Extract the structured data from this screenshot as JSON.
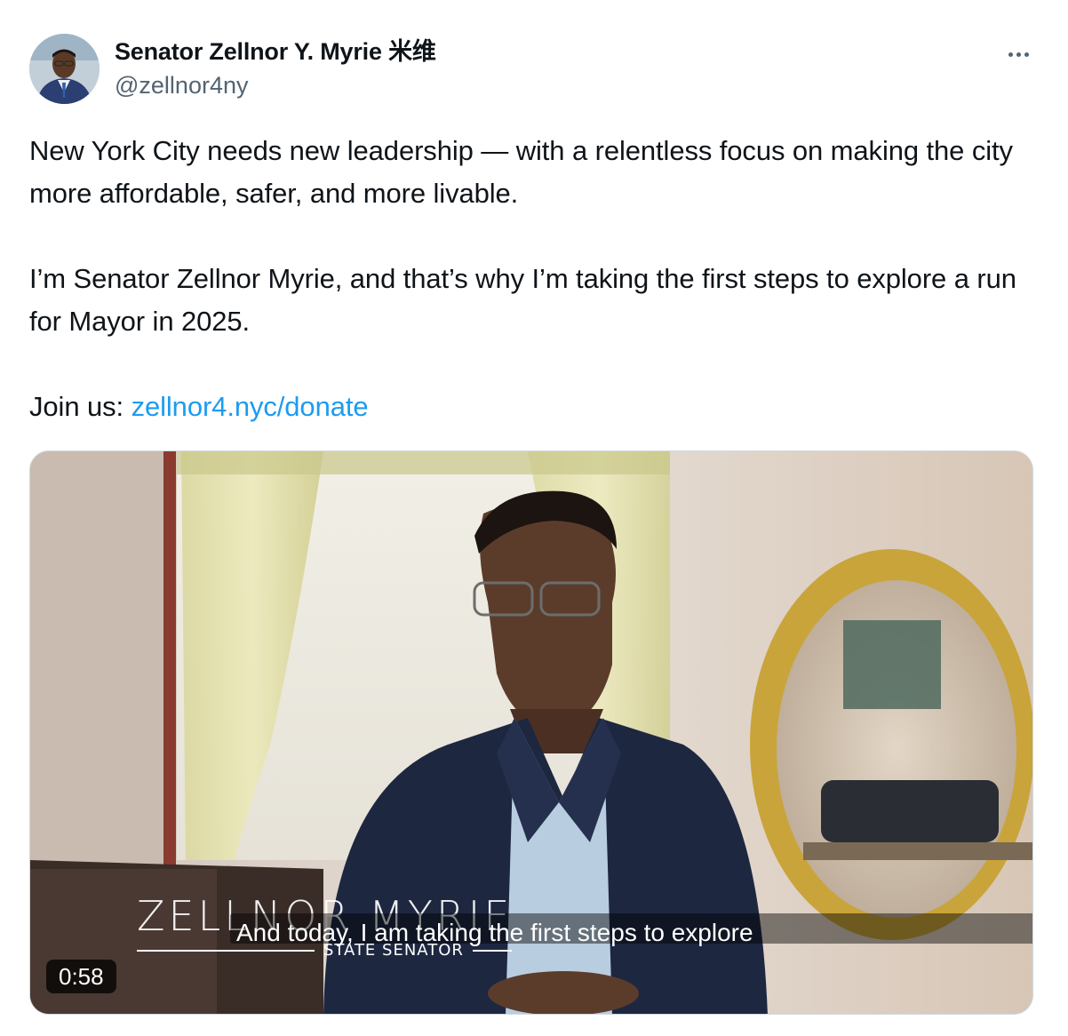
{
  "author": {
    "display_name": "Senator Zellnor Y. Myrie 米维",
    "handle": "@zellnor4ny",
    "avatar_icon": "profile-avatar"
  },
  "more_icon": "more-options-icon",
  "tweet": {
    "paragraph1": "New York City needs new leadership — with a relentless focus on making the city more affordable, safer, and more livable.",
    "paragraph2": "I’m Senator Zellnor Myrie, and that’s why I’m taking the first steps to explore a run for Mayor in 2025.",
    "join_prefix": "Join us: ",
    "link_text": "zellnor4.nyc/donate"
  },
  "video": {
    "lower_third_name": "ZELLNOR MYRIE",
    "lower_third_title": "STATE SENATOR",
    "caption": "And today, I am taking the first steps to explore",
    "duration": "0:58"
  },
  "colors": {
    "text": "#0f1419",
    "secondary": "#536471",
    "link": "#1d9bf0"
  }
}
